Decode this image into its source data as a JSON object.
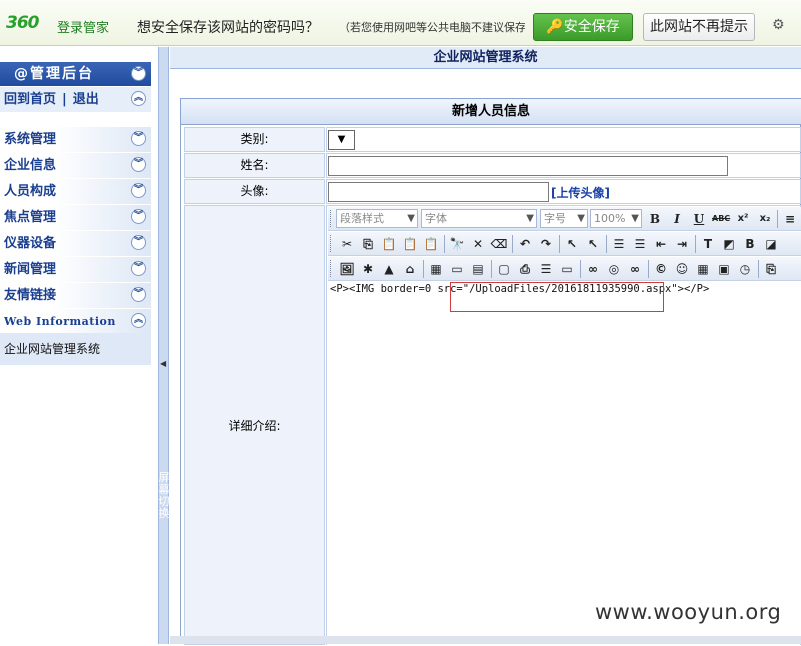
{
  "bar360": {
    "logo": "360",
    "logo_text": "登录管家",
    "question": "想安全保存该网站的密码吗？",
    "note": "（若您使用网吧等公共电脑不建议保存）",
    "save_button": "安全保存",
    "nomore_button": "此网站不再提示",
    "settings_icon": "gear-icon"
  },
  "sidebar": {
    "title": "@管理后台",
    "links": {
      "home": "回到首页",
      "sep": "|",
      "logout": "退出"
    },
    "menu": [
      {
        "label": "系统管理"
      },
      {
        "label": "企业信息"
      },
      {
        "label": "人员构成"
      },
      {
        "label": "焦点管理"
      },
      {
        "label": "仪器设备"
      },
      {
        "label": "新闻管理"
      },
      {
        "label": "友情链接"
      },
      {
        "label": "Web Information"
      }
    ],
    "bottom": "企业网站管理系统"
  },
  "splitter": {
    "label": "屏幕切换"
  },
  "main": {
    "title": "企业网站管理系统",
    "form": {
      "title": "新增人员信息",
      "category_label": "类别:",
      "name_label": "姓名:",
      "avatar_label": "头像:",
      "upload_link": "[上传头像]",
      "detail_label": "详细介绍:",
      "editor": {
        "paragraph_style": "段落样式",
        "font": "字体",
        "font_size": "字号",
        "zoom": "100%",
        "source": "<P><IMG border=0 src=\"/UploadFiles/20161811935990.aspx\"></P>"
      }
    }
  },
  "watermark": "www.wooyun.org"
}
